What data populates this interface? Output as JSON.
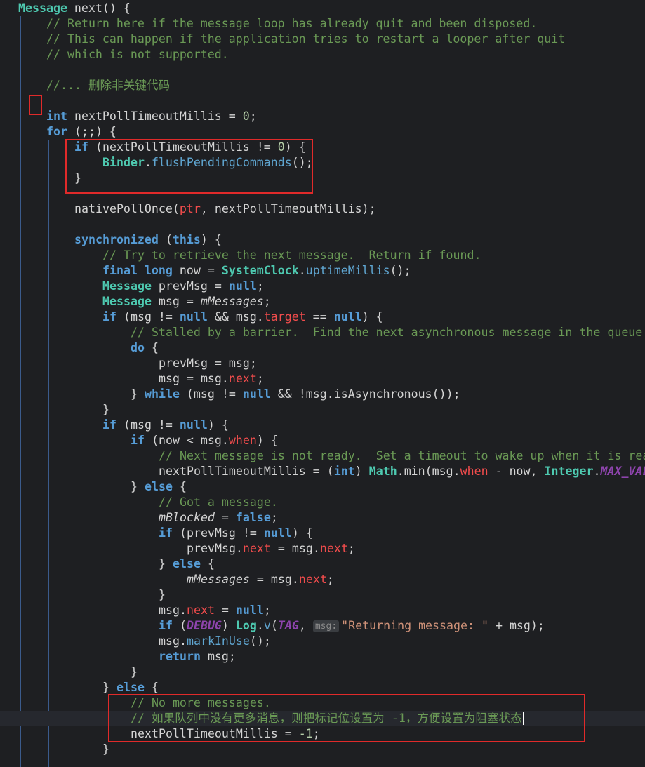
{
  "editor": {
    "lines": [
      {
        "indent": 0,
        "tokens": [
          [
            "cls",
            "Message"
          ],
          [
            "txt",
            " next() {"
          ]
        ]
      },
      {
        "indent": 1,
        "tokens": [
          [
            "cm",
            "// Return here if the message loop has already quit and been disposed."
          ]
        ]
      },
      {
        "indent": 1,
        "tokens": [
          [
            "cm",
            "// This can happen if the application tries to restart a looper after quit"
          ]
        ]
      },
      {
        "indent": 1,
        "tokens": [
          [
            "cm",
            "// which is not supported."
          ]
        ]
      },
      {
        "indent": 1,
        "tokens": []
      },
      {
        "indent": 1,
        "tokens": [
          [
            "cm",
            "//... 删除非关键代码"
          ]
        ]
      },
      {
        "indent": 1,
        "tokens": []
      },
      {
        "indent": 1,
        "tokens": [
          [
            "kw",
            "int"
          ],
          [
            "txt",
            " nextPollTimeoutMillis = "
          ],
          [
            "num",
            "0"
          ],
          [
            "txt",
            ";"
          ]
        ]
      },
      {
        "indent": 1,
        "tokens": [
          [
            "kw",
            "for"
          ],
          [
            "txt",
            " (;;) {"
          ]
        ]
      },
      {
        "indent": 2,
        "tokens": [
          [
            "kw",
            "if"
          ],
          [
            "txt",
            " (nextPollTimeoutMillis != "
          ],
          [
            "num",
            "0"
          ],
          [
            "txt",
            ") {"
          ]
        ]
      },
      {
        "indent": 3,
        "tokens": [
          [
            "cls",
            "Binder"
          ],
          [
            "txt",
            "."
          ],
          [
            "mth",
            "flushPendingCommands"
          ],
          [
            "txt",
            "();"
          ]
        ]
      },
      {
        "indent": 2,
        "tokens": [
          [
            "txt",
            "}"
          ]
        ]
      },
      {
        "indent": 2,
        "tokens": []
      },
      {
        "indent": 2,
        "tokens": [
          [
            "txt",
            "nativePollOnce("
          ],
          [
            "fld",
            "ptr"
          ],
          [
            "txt",
            ", nextPollTimeoutMillis);"
          ]
        ]
      },
      {
        "indent": 2,
        "tokens": []
      },
      {
        "indent": 2,
        "tokens": [
          [
            "kw",
            "synchronized"
          ],
          [
            "txt",
            " ("
          ],
          [
            "kw",
            "this"
          ],
          [
            "txt",
            ") {"
          ]
        ]
      },
      {
        "indent": 3,
        "tokens": [
          [
            "cm",
            "// Try to retrieve the next message.  Return if found."
          ]
        ]
      },
      {
        "indent": 3,
        "tokens": [
          [
            "kw",
            "final long"
          ],
          [
            "txt",
            " now = "
          ],
          [
            "cls",
            "SystemClock"
          ],
          [
            "txt",
            "."
          ],
          [
            "mth",
            "uptimeMillis"
          ],
          [
            "txt",
            "();"
          ]
        ]
      },
      {
        "indent": 3,
        "tokens": [
          [
            "cls",
            "Message"
          ],
          [
            "txt",
            " prevMsg = "
          ],
          [
            "kw",
            "null"
          ],
          [
            "txt",
            ";"
          ]
        ]
      },
      {
        "indent": 3,
        "tokens": [
          [
            "cls",
            "Message"
          ],
          [
            "txt",
            " msg = "
          ],
          [
            "ifld",
            "mMessages"
          ],
          [
            "txt",
            ";"
          ]
        ]
      },
      {
        "indent": 3,
        "tokens": [
          [
            "kw",
            "if"
          ],
          [
            "txt",
            " (msg != "
          ],
          [
            "kw",
            "null"
          ],
          [
            "txt",
            " && msg."
          ],
          [
            "fld",
            "target"
          ],
          [
            "txt",
            " == "
          ],
          [
            "kw",
            "null"
          ],
          [
            "txt",
            ") {"
          ]
        ]
      },
      {
        "indent": 4,
        "tokens": [
          [
            "cm",
            "// Stalled by a barrier.  Find the next asynchronous message in the queue."
          ]
        ]
      },
      {
        "indent": 4,
        "tokens": [
          [
            "kw",
            "do"
          ],
          [
            "txt",
            " {"
          ]
        ]
      },
      {
        "indent": 5,
        "tokens": [
          [
            "txt",
            "prevMsg = msg;"
          ]
        ]
      },
      {
        "indent": 5,
        "tokens": [
          [
            "txt",
            "msg = msg."
          ],
          [
            "fld",
            "next"
          ],
          [
            "txt",
            ";"
          ]
        ]
      },
      {
        "indent": 4,
        "tokens": [
          [
            "txt",
            "} "
          ],
          [
            "kw",
            "while"
          ],
          [
            "txt",
            " (msg != "
          ],
          [
            "kw",
            "null"
          ],
          [
            "txt",
            " && !msg.isAsynchronous());"
          ]
        ]
      },
      {
        "indent": 3,
        "tokens": [
          [
            "txt",
            "}"
          ]
        ]
      },
      {
        "indent": 3,
        "tokens": [
          [
            "kw",
            "if"
          ],
          [
            "txt",
            " (msg != "
          ],
          [
            "kw",
            "null"
          ],
          [
            "txt",
            ") {"
          ]
        ]
      },
      {
        "indent": 4,
        "tokens": [
          [
            "kw",
            "if"
          ],
          [
            "txt",
            " (now < msg."
          ],
          [
            "fld",
            "when"
          ],
          [
            "txt",
            ") {"
          ]
        ]
      },
      {
        "indent": 5,
        "tokens": [
          [
            "cm",
            "// Next message is not ready.  Set a timeout to wake up when it is ready."
          ]
        ]
      },
      {
        "indent": 5,
        "tokens": [
          [
            "txt",
            "nextPollTimeoutMillis = ("
          ],
          [
            "kw",
            "int"
          ],
          [
            "txt",
            ") "
          ],
          [
            "cls",
            "Math"
          ],
          [
            "txt",
            ".min(msg."
          ],
          [
            "fld",
            "when"
          ],
          [
            "txt",
            " - now, "
          ],
          [
            "cls",
            "Integer"
          ],
          [
            "txt",
            "."
          ],
          [
            "cst",
            "MAX_VALUE"
          ],
          [
            "txt",
            ");"
          ]
        ]
      },
      {
        "indent": 4,
        "tokens": [
          [
            "txt",
            "} "
          ],
          [
            "kw",
            "else"
          ],
          [
            "txt",
            " {"
          ]
        ]
      },
      {
        "indent": 5,
        "tokens": [
          [
            "cm",
            "// Got a message."
          ]
        ]
      },
      {
        "indent": 5,
        "tokens": [
          [
            "ifld",
            "mBlocked"
          ],
          [
            "txt",
            " = "
          ],
          [
            "kw",
            "false"
          ],
          [
            "txt",
            ";"
          ]
        ]
      },
      {
        "indent": 5,
        "tokens": [
          [
            "kw",
            "if"
          ],
          [
            "txt",
            " (prevMsg != "
          ],
          [
            "kw",
            "null"
          ],
          [
            "txt",
            ") {"
          ]
        ]
      },
      {
        "indent": 6,
        "tokens": [
          [
            "txt",
            "prevMsg."
          ],
          [
            "fld",
            "next"
          ],
          [
            "txt",
            " = msg."
          ],
          [
            "fld",
            "next"
          ],
          [
            "txt",
            ";"
          ]
        ]
      },
      {
        "indent": 5,
        "tokens": [
          [
            "txt",
            "} "
          ],
          [
            "kw",
            "else"
          ],
          [
            "txt",
            " {"
          ]
        ]
      },
      {
        "indent": 6,
        "tokens": [
          [
            "ifld",
            "mMessages"
          ],
          [
            "txt",
            " = msg."
          ],
          [
            "fld",
            "next"
          ],
          [
            "txt",
            ";"
          ]
        ]
      },
      {
        "indent": 5,
        "tokens": [
          [
            "txt",
            "}"
          ]
        ]
      },
      {
        "indent": 5,
        "tokens": [
          [
            "txt",
            "msg."
          ],
          [
            "fld",
            "next"
          ],
          [
            "txt",
            " = "
          ],
          [
            "kw",
            "null"
          ],
          [
            "txt",
            ";"
          ]
        ]
      },
      {
        "indent": 5,
        "tokens": [
          [
            "kw",
            "if"
          ],
          [
            "txt",
            " ("
          ],
          [
            "cst",
            "DEBUG"
          ],
          [
            "txt",
            ") "
          ],
          [
            "cls",
            "Log"
          ],
          [
            "txt",
            "."
          ],
          [
            "mth",
            "v"
          ],
          [
            "txt",
            "("
          ],
          [
            "cst",
            "TAG"
          ],
          [
            "txt",
            ", "
          ],
          [
            "hint",
            "msg:"
          ],
          [
            "str",
            "\"Returning message: \""
          ],
          [
            "txt",
            " + msg);"
          ]
        ]
      },
      {
        "indent": 5,
        "tokens": [
          [
            "txt",
            "msg."
          ],
          [
            "mth",
            "markInUse"
          ],
          [
            "txt",
            "();"
          ]
        ]
      },
      {
        "indent": 5,
        "tokens": [
          [
            "kw",
            "return"
          ],
          [
            "txt",
            " msg;"
          ]
        ]
      },
      {
        "indent": 4,
        "tokens": [
          [
            "txt",
            "}"
          ]
        ]
      },
      {
        "indent": 3,
        "tokens": [
          [
            "txt",
            "} "
          ],
          [
            "kw",
            "else"
          ],
          [
            "txt",
            " {"
          ]
        ]
      },
      {
        "indent": 4,
        "tokens": [
          [
            "cm",
            "// No more messages."
          ]
        ]
      },
      {
        "indent": 4,
        "tokens": [
          [
            "cm",
            "// 如果队列中没有更多消息，则把标记位设置为 -1，方便设置为阻塞状态"
          ]
        ]
      },
      {
        "indent": 4,
        "tokens": [
          [
            "txt",
            "nextPollTimeoutMillis = "
          ],
          [
            "num",
            "-1"
          ],
          [
            "txt",
            ";"
          ]
        ]
      },
      {
        "indent": 3,
        "tokens": [
          [
            "txt",
            "}"
          ]
        ]
      }
    ]
  }
}
